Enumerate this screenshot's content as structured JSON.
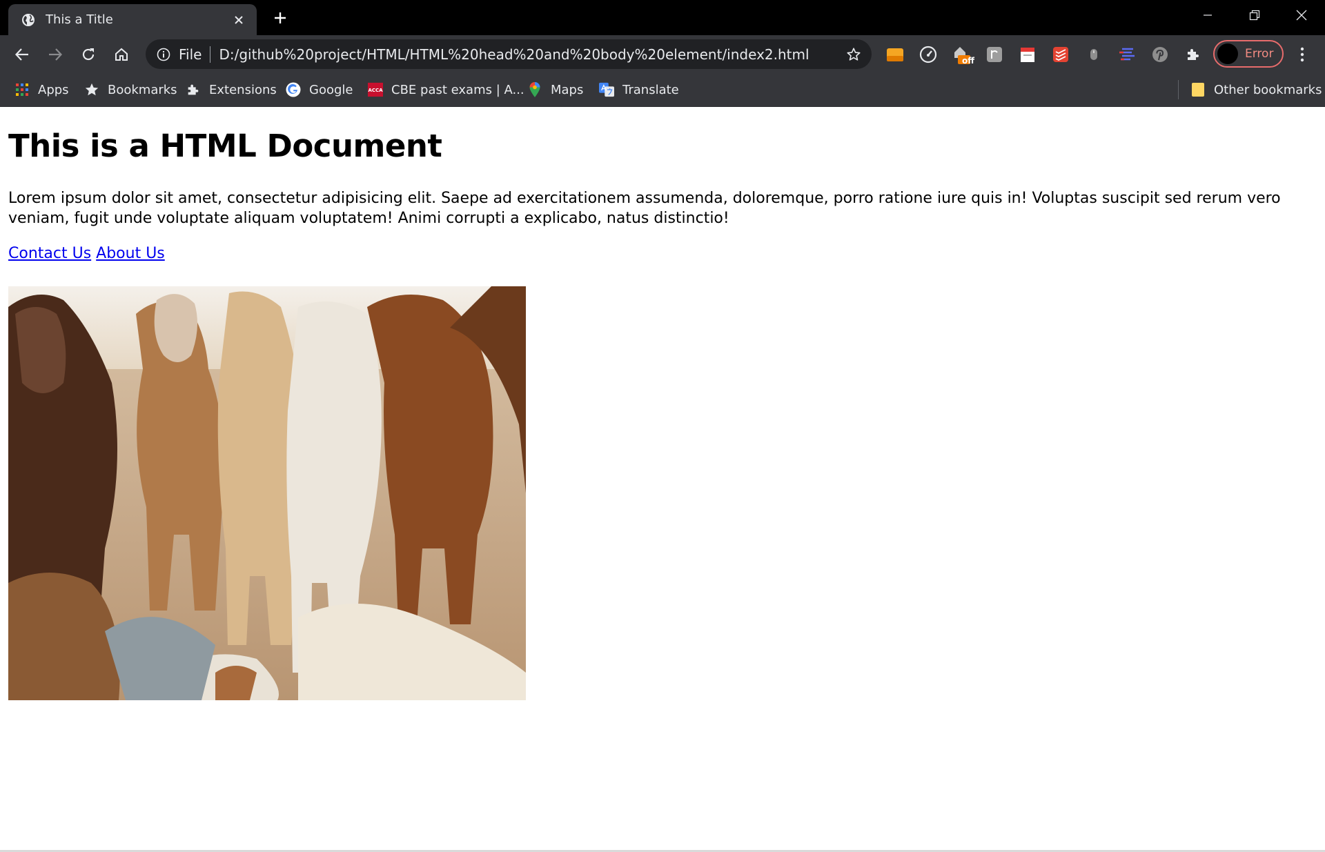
{
  "tab": {
    "title": "This a Title"
  },
  "omnibox": {
    "scheme": "File",
    "url": "D:/github%20project/HTML/HTML%20head%20and%20body%20element/index2.html"
  },
  "extensions": {
    "badge_off": "off"
  },
  "profile": {
    "label": "Error"
  },
  "bookmarks": {
    "items": [
      {
        "label": "Apps",
        "icon": "apps-grid-icon"
      },
      {
        "label": "Bookmarks",
        "icon": "star-icon"
      },
      {
        "label": "Extensions",
        "icon": "puzzle-icon"
      },
      {
        "label": "Google",
        "icon": "google-icon"
      },
      {
        "label": "CBE past exams | A...",
        "icon": "acca-icon"
      },
      {
        "label": "Maps",
        "icon": "maps-pin-icon"
      },
      {
        "label": "Translate",
        "icon": "translate-icon"
      }
    ],
    "other": "Other bookmarks",
    "acca_text": "ACCA"
  },
  "page": {
    "heading": "This is a HTML Document",
    "paragraph": "Lorem ipsum dolor sit amet, consectetur adipisicing elit. Saepe ad exercitationem assumenda, doloremque, porro ratione iure quis in! Voluptas suscipit sed rerum vero veniam, fugit unde voluptate aliquam voluptatem! Animi corrupti a explicabo, natus distinctio!",
    "links": [
      "Contact Us",
      "About Us"
    ]
  },
  "colors": {
    "chrome_dark": "#35363a",
    "link": "#0000ee",
    "profile_border": "#e86c6c"
  }
}
